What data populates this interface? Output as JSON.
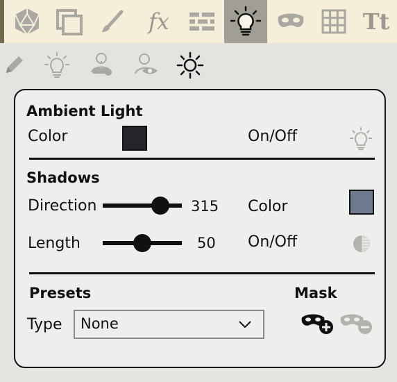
{
  "toolbar": {
    "buttons": [
      {
        "name": "dice-icon"
      },
      {
        "name": "layers-icon"
      },
      {
        "name": "brush-icon"
      },
      {
        "name": "fx-icon",
        "text": "fx"
      },
      {
        "name": "wall-icon"
      },
      {
        "name": "lighting-icon",
        "active": true
      },
      {
        "name": "mask-icon"
      },
      {
        "name": "grid-icon"
      },
      {
        "name": "text-icon",
        "text": "Tt"
      }
    ]
  },
  "tabs": [
    {
      "name": "pencil-icon"
    },
    {
      "name": "light-bulb-icon"
    },
    {
      "name": "light-person-icon"
    },
    {
      "name": "vision-icon"
    },
    {
      "name": "sun-icon",
      "active": true
    }
  ],
  "ambient": {
    "title": "Ambient Light",
    "color_label": "Color",
    "color": "#23252b",
    "onoff_label": "On/Off"
  },
  "shadows": {
    "title": "Shadows",
    "direction_label": "Direction",
    "direction_value": "315",
    "direction_fraction": 0.79,
    "color_label": "Color",
    "color": "#6d7a8e",
    "length_label": "Length",
    "length_value": "50",
    "length_fraction": 0.5,
    "onoff_label": "On/Off"
  },
  "presets": {
    "title": "Presets",
    "type_label": "Type",
    "type_value": "None"
  },
  "mask": {
    "title": "Mask"
  }
}
